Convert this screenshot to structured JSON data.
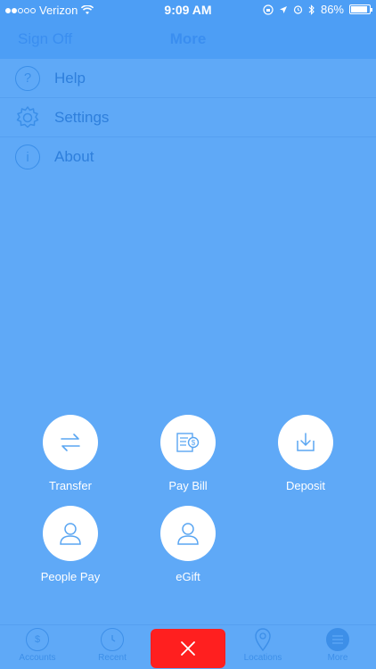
{
  "status_bar": {
    "carrier": "Verizon",
    "time": "9:09 AM",
    "battery": "86%"
  },
  "nav_bar": {
    "left_button": "Sign Off",
    "title": "More"
  },
  "menu": {
    "items": [
      {
        "label": "Help",
        "icon": "question-icon"
      },
      {
        "label": "Settings",
        "icon": "gear-icon"
      },
      {
        "label": "About",
        "icon": "info-icon"
      }
    ]
  },
  "actions": [
    {
      "label": "Transfer",
      "icon": "transfer-arrows-icon"
    },
    {
      "label": "Pay Bill",
      "icon": "bill-icon"
    },
    {
      "label": "Deposit",
      "icon": "deposit-icon"
    },
    {
      "label": "People Pay",
      "icon": "person-icon"
    },
    {
      "label": "eGift",
      "icon": "person-icon"
    }
  ],
  "tab_bar": {
    "tabs": [
      {
        "label": "Accounts",
        "icon": "dollar-icon"
      },
      {
        "label": "Recent",
        "icon": "clock-icon"
      },
      {
        "label": "Locations",
        "icon": "location-pin-icon"
      },
      {
        "label": "More",
        "icon": "menu-icon"
      }
    ],
    "close_icon": "close-icon"
  },
  "colors": {
    "background": "#5fa9f7",
    "close_button": "#ff1f1f",
    "action_icon": "#5aa6f2"
  }
}
